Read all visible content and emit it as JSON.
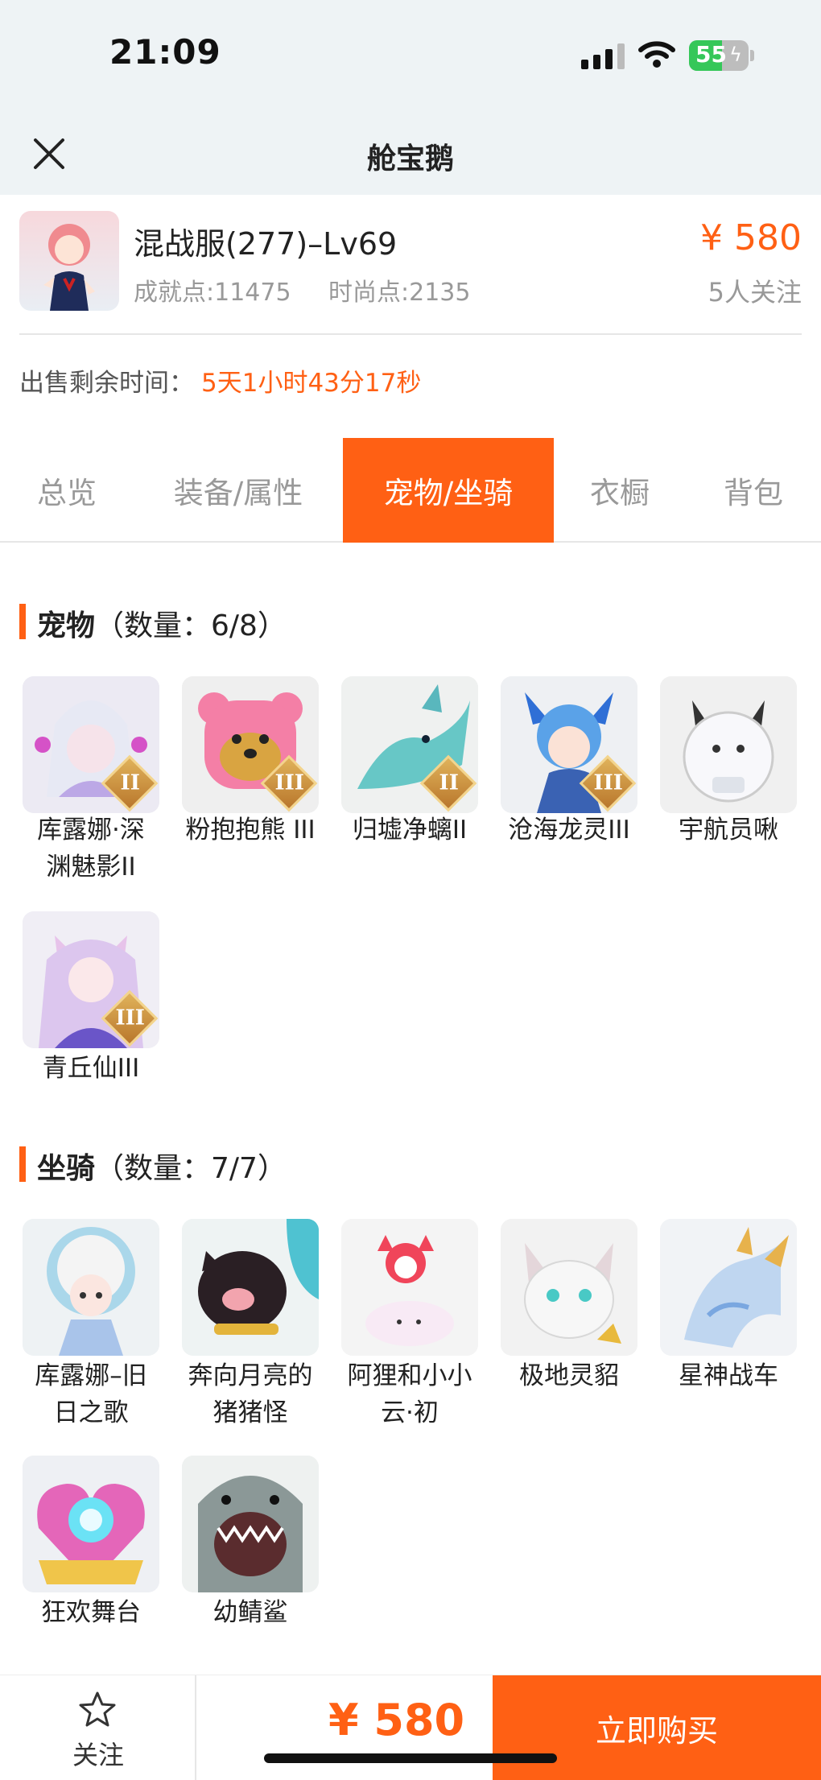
{
  "status_bar": {
    "time": "21:09",
    "battery": "55",
    "battery_level_percent": 55
  },
  "nav": {
    "title": "舱宝鹅"
  },
  "account": {
    "server": "混战服(277)–Lv69",
    "achievement": "成就点:11475",
    "fashion": "时尚点:2135",
    "price": "¥ 580",
    "watchers": "5人关注"
  },
  "sale": {
    "remaining_label": "出售剩余时间：",
    "remaining_value": "5天1小时43分17秒"
  },
  "tabs": [
    {
      "label": "总览",
      "active": false
    },
    {
      "label": "装备/属性",
      "active": false
    },
    {
      "label": "宠物/坐骑",
      "active": true
    },
    {
      "label": "衣橱",
      "active": false
    },
    {
      "label": "背包",
      "active": false
    }
  ],
  "pets": {
    "title": "宠物",
    "count_text": "（数量：6/8）",
    "items": [
      {
        "name_line1": "库露娜·深",
        "name_line2": "渊魅影II",
        "badge": "II"
      },
      {
        "name_line1": "粉抱抱熊 III",
        "name_line2": "",
        "badge": "III"
      },
      {
        "name_line1": "归墟净螭II",
        "name_line2": "",
        "badge": "II"
      },
      {
        "name_line1": "沧海龙灵III",
        "name_line2": "",
        "badge": "III"
      },
      {
        "name_line1": "宇航员啾",
        "name_line2": "",
        "badge": ""
      },
      {
        "name_line1": "青丘仙III",
        "name_line2": "",
        "badge": "III"
      }
    ]
  },
  "mounts": {
    "title": "坐骑",
    "count_text": "（数量：7/7）",
    "items": [
      {
        "name_line1": "库露娜–旧",
        "name_line2": "日之歌"
      },
      {
        "name_line1": "奔向月亮的",
        "name_line2": "猪猪怪"
      },
      {
        "name_line1": "阿狸和小小",
        "name_line2": "云·初"
      },
      {
        "name_line1": "极地灵貂",
        "name_line2": ""
      },
      {
        "name_line1": "星神战车",
        "name_line2": ""
      },
      {
        "name_line1": "狂欢舞台",
        "name_line2": ""
      },
      {
        "name_line1": "幼鲭鲨",
        "name_line2": ""
      }
    ]
  },
  "bottom": {
    "follow_label": "关注",
    "price": "¥ 580",
    "buy_label": "立即购买"
  },
  "colors": {
    "accent": "#ff6014",
    "top_bg": "#eef3f5",
    "muted_text": "#999999"
  }
}
